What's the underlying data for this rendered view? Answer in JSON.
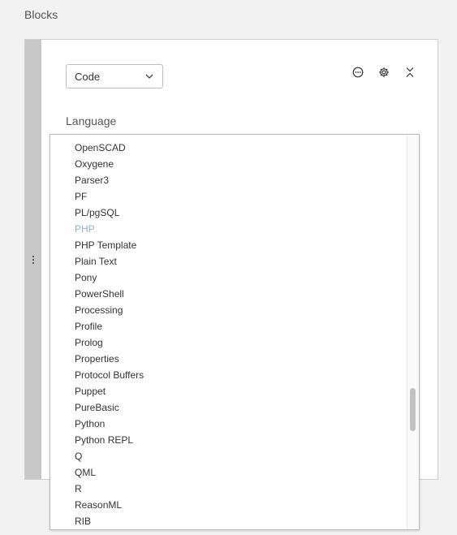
{
  "page": {
    "title": "Blocks"
  },
  "block": {
    "type_select": {
      "value": "Code",
      "icon": "chevron-down-icon"
    },
    "toolbar": {
      "more_icon": "more-options-icon",
      "settings_icon": "gear-icon",
      "collapse_icon": "collapse-icon"
    },
    "language_label": "Language"
  },
  "language_dropdown": {
    "selected": "PHP",
    "options": [
      "OpenSCAD",
      "Oxygene",
      "Parser3",
      "PF",
      "PL/pgSQL",
      "PHP",
      "PHP Template",
      "Plain Text",
      "Pony",
      "PowerShell",
      "Processing",
      "Profile",
      "Prolog",
      "Properties",
      "Protocol Buffers",
      "Puppet",
      "PureBasic",
      "Python",
      "Python REPL",
      "Q",
      "QML",
      "R",
      "ReasonML",
      "RIB"
    ],
    "scroll_position": 0.72,
    "scroll_visible_fraction": 0.11
  },
  "colors": {
    "selected_option": "#7ab7d6",
    "drag_handle": "#c8c8c8",
    "background": "#f2f2f2"
  }
}
